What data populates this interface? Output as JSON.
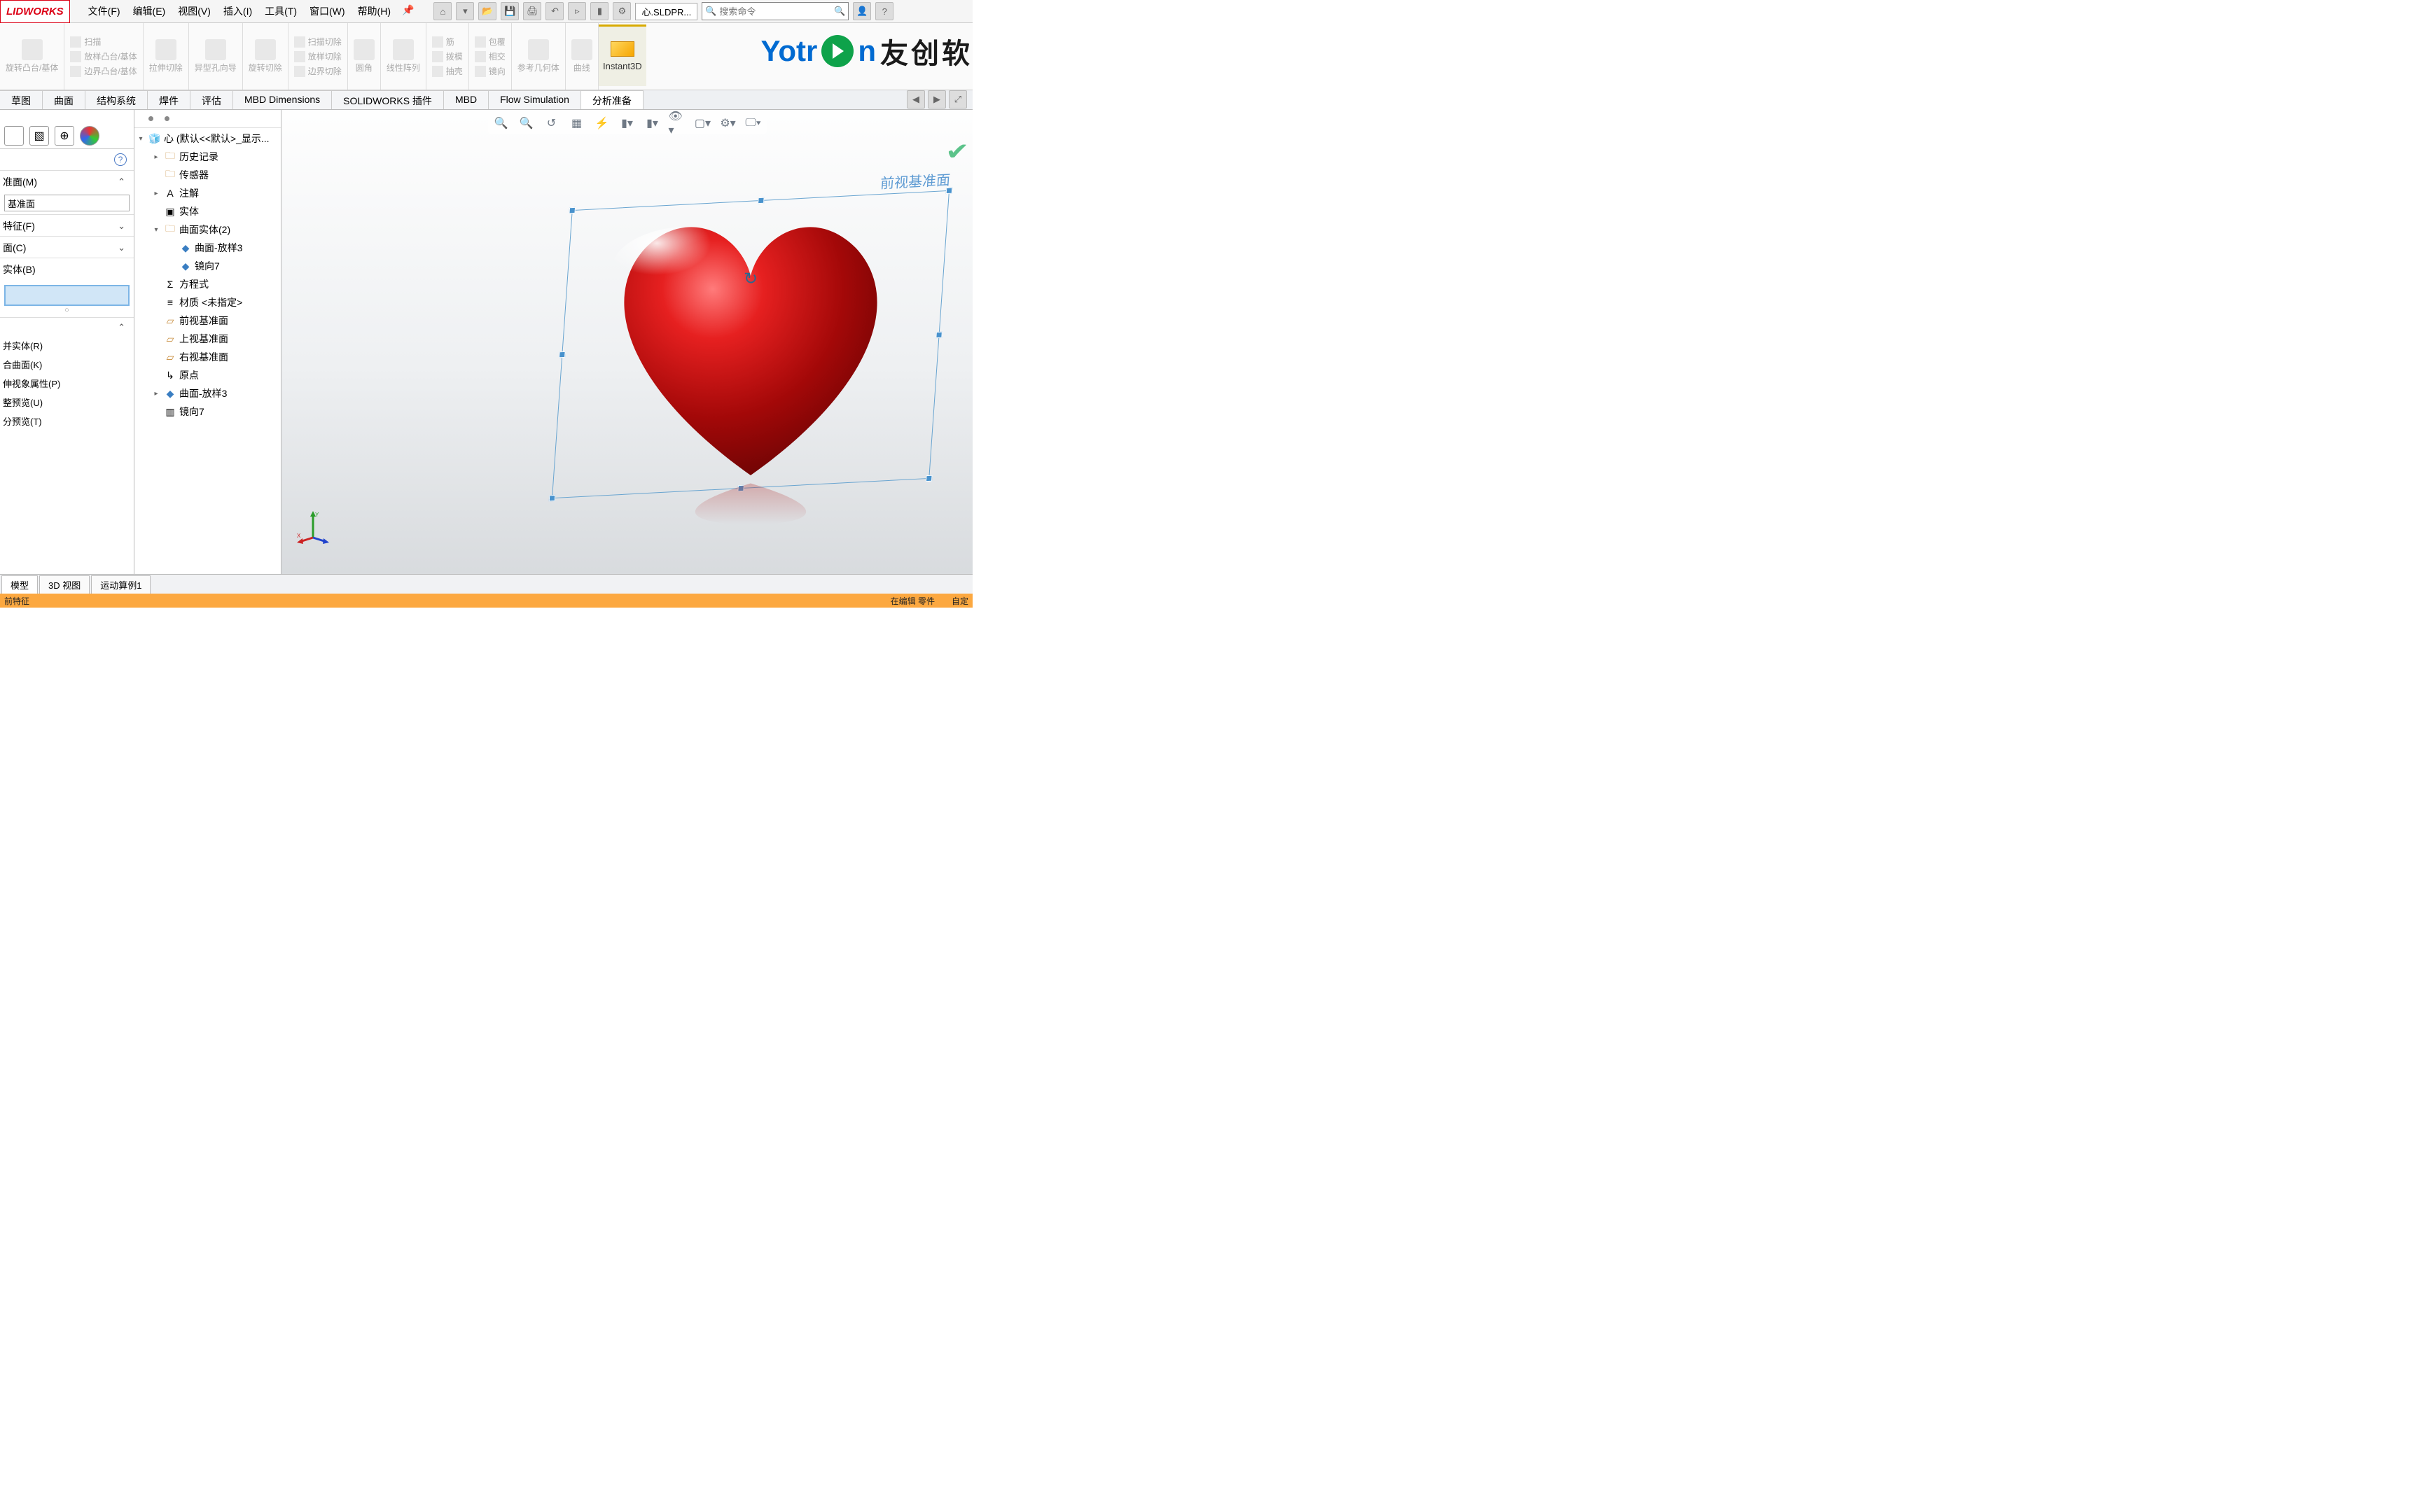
{
  "app": {
    "logo": "LIDWORKS"
  },
  "menu": {
    "file": "文件(F)",
    "edit": "编辑(E)",
    "view": "视图(V)",
    "insert": "插入(I)",
    "tools": "工具(T)",
    "window": "窗口(W)",
    "help": "帮助(H)"
  },
  "titlebar": {
    "doc": "心.SLDPR...",
    "search_placeholder": "搜索命令"
  },
  "ribbon": {
    "sweep": "扫描",
    "loft": "放样凸台/基体",
    "boundary": "边界凸台/基体",
    "extr_cut": "拉伸切除",
    "hole": "异型孔向导",
    "rev_cut": "旋转切除",
    "sweep_cut": "扫描切除",
    "loft_cut": "放样切除",
    "bound_cut": "边界切除",
    "fillet": "圆角",
    "lpattern": "线性阵列",
    "rib": "筋",
    "draft": "拨模",
    "shell": "抽壳",
    "wrap": "包覆",
    "intersect": "相交",
    "mirror": "镜向",
    "refgeom": "参考几何体",
    "curve": "曲线",
    "instant3d": "Instant3D"
  },
  "tabs": [
    "草图",
    "曲面",
    "结构系统",
    "焊件",
    "评估",
    "MBD Dimensions",
    "SOLIDWORKS 插件",
    "MBD",
    "Flow Simulation",
    "分析准备"
  ],
  "pm": {
    "section_m": "准面(M)",
    "input_m": "基准面",
    "section_f": "特征(F)",
    "section_c": "面(C)",
    "section_b": "实体(B)",
    "opts_label": "并实体(R)",
    "opt2": "合曲面(K)",
    "opt3": "伸视象属性(P)",
    "opt4": "整预览(U)",
    "opt5": "分预览(T)"
  },
  "tree": {
    "root": "心  (默认<<默认>_显示...",
    "history": "历史记录",
    "sensors": "传感器",
    "annotations": "注解",
    "solid": "实体",
    "surfbodies": "曲面实体(2)",
    "surf_loft3": "曲面-放样3",
    "mirror7": "镜向7",
    "equations": "方程式",
    "material": "材质 <未指定>",
    "front": "前视基准面",
    "top": "上视基准面",
    "right": "右视基准面",
    "origin": "原点",
    "loft3": "曲面-放样3",
    "mirror7b": "镜向7"
  },
  "viewport": {
    "plane_label": "前视基准面"
  },
  "bottom_tabs": [
    "模型",
    "3D 视图",
    "运动算例1"
  ],
  "status": {
    "left": "前特征",
    "right1": "在编辑 零件",
    "right2": "自定"
  },
  "overlay": {
    "brand": "Yotr",
    "brand2": "n",
    "cn": "友创软"
  }
}
